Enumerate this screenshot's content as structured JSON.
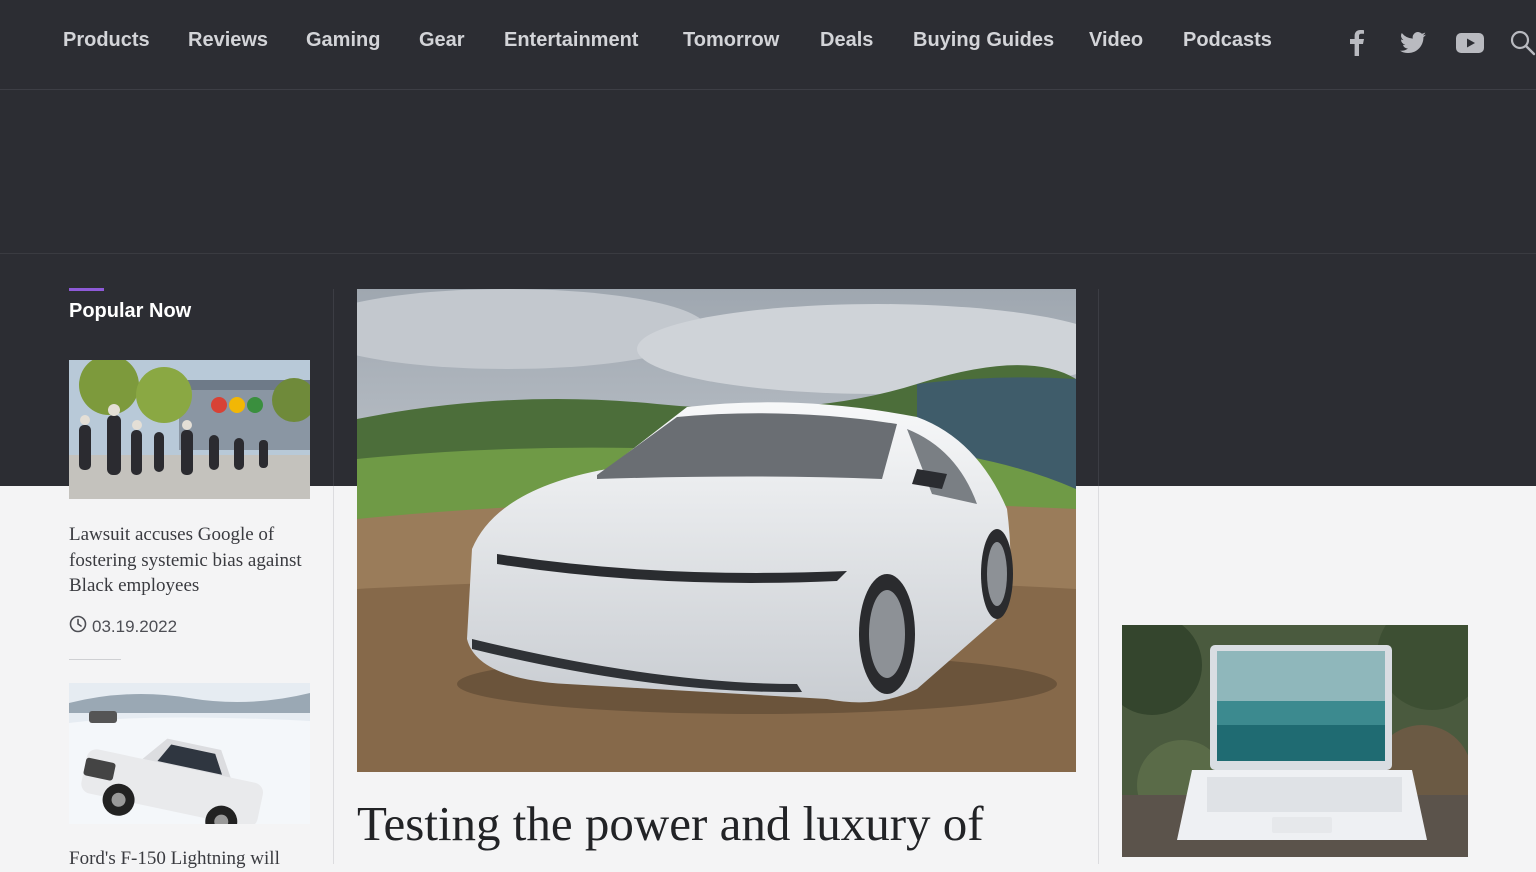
{
  "nav": {
    "items": [
      {
        "label": "Products"
      },
      {
        "label": "Reviews"
      },
      {
        "label": "Gaming"
      },
      {
        "label": "Gear"
      },
      {
        "label": "Entertainment"
      },
      {
        "label": "Tomorrow"
      },
      {
        "label": "Deals"
      },
      {
        "label": "Buying Guides"
      },
      {
        "label": "Video"
      },
      {
        "label": "Podcasts"
      }
    ],
    "social_icons": [
      "facebook-icon",
      "twitter-icon",
      "youtube-icon",
      "search-icon"
    ]
  },
  "popular": {
    "title": "Popular Now",
    "items": [
      {
        "headline": "Lawsuit accuses Google of fostering systemic bias against Black employees",
        "date": "03.19.2022",
        "image": "google-campus-photo"
      },
      {
        "headline": "Ford's F-150 Lightning will",
        "image": "ford-truck-snow-photo"
      }
    ]
  },
  "hero": {
    "headline": "Testing the power and luxury of",
    "image": "white-sedan-hills-photo"
  },
  "sidebar": {
    "image": "laptop-outdoors-photo"
  },
  "colors": {
    "header_bg": "#2c2d33",
    "page_bg": "#f4f4f5",
    "accent": "#8e5ad8"
  }
}
